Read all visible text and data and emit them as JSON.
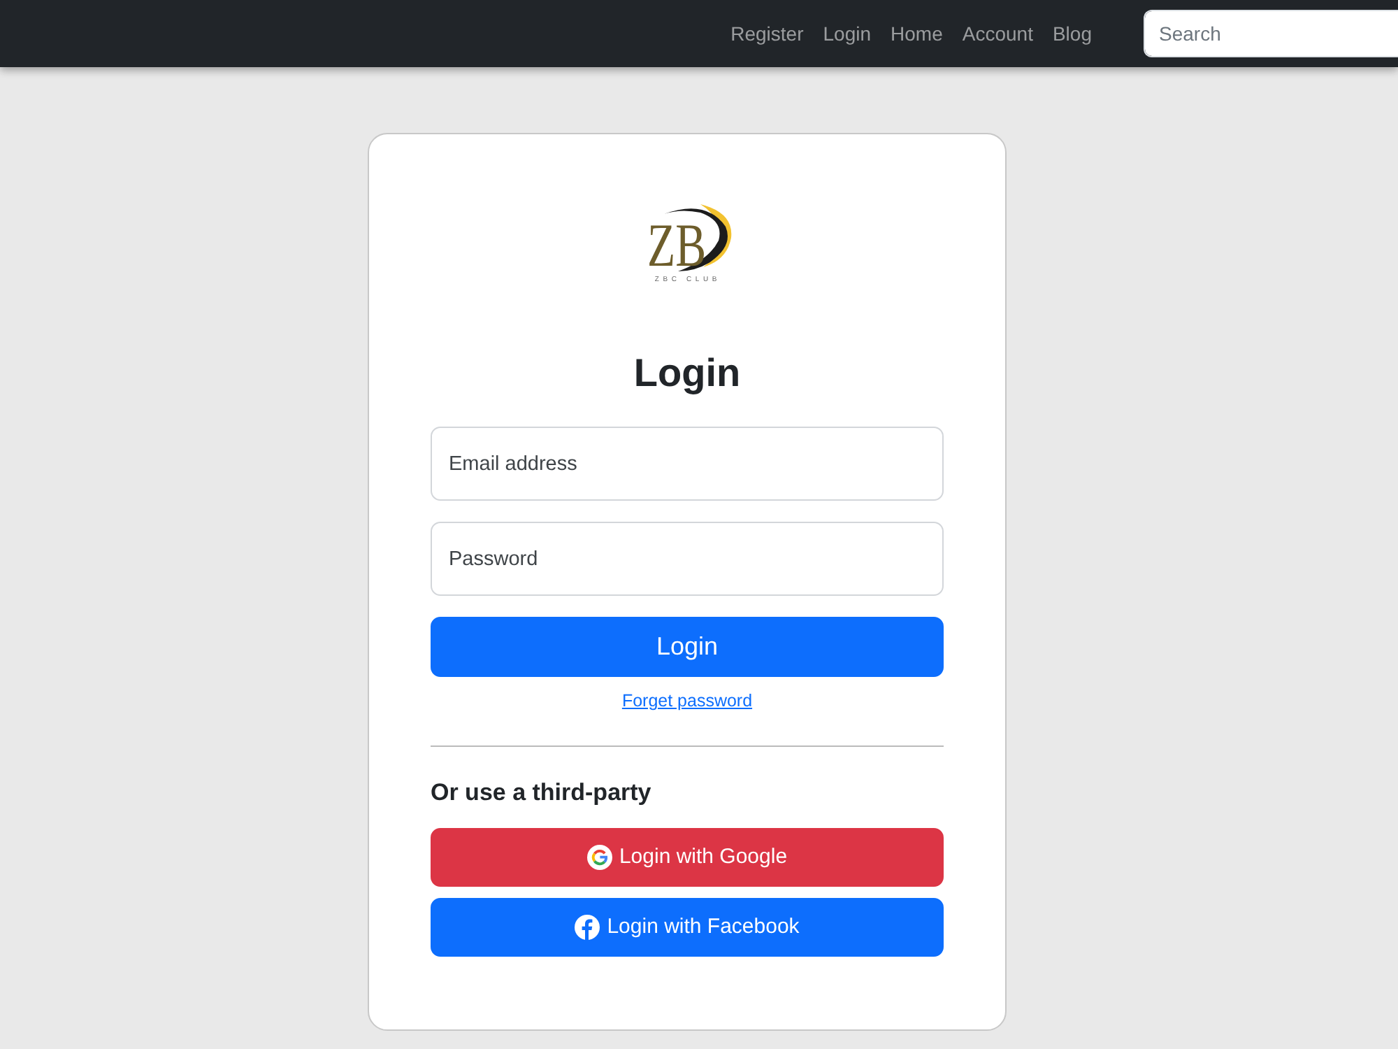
{
  "navbar": {
    "links": [
      "Register",
      "Login",
      "Home",
      "Account",
      "Blog"
    ],
    "search": {
      "placeholder": "Search"
    }
  },
  "login_card": {
    "logo": {
      "monogram": "ZB",
      "caption": "ZBC CLUB"
    },
    "title": "Login",
    "fields": [
      {
        "placeholder": "Email address"
      },
      {
        "placeholder": "Password"
      }
    ],
    "submit_button": "Login",
    "forgot_link": "Forget password",
    "third_party_heading": "Or use a third-party",
    "providers": [
      {
        "kind": "google",
        "label": "Login with Google"
      },
      {
        "kind": "facebook",
        "label": "Login with Facebook"
      }
    ]
  }
}
